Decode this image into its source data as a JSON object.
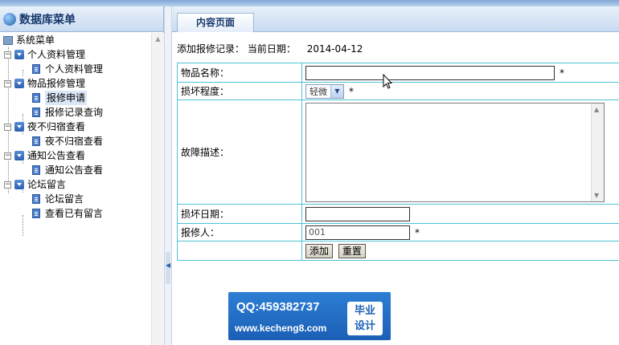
{
  "menu": {
    "title": "数据库菜单",
    "root": "系统菜单",
    "groups": [
      {
        "label": "个人资料管理",
        "items": [
          "个人资料管理"
        ]
      },
      {
        "label": "物品报修管理",
        "items": [
          "报修申请",
          "报修记录查询"
        ]
      },
      {
        "label": "夜不归宿查看",
        "items": [
          "夜不归宿查看"
        ]
      },
      {
        "label": "通知公告查看",
        "items": [
          "通知公告查看"
        ]
      },
      {
        "label": "论坛留言",
        "items": [
          "论坛留言",
          "查看已有留言"
        ]
      }
    ]
  },
  "content": {
    "tab": "内容页面",
    "caption": "添加报修记录：",
    "date_label": "当前日期：",
    "date_value": "2014-04-12",
    "form": {
      "item_name_label": "物品名称：",
      "item_name_value": "",
      "damage_label": "损坏程度：",
      "damage_selected": "轻微",
      "desc_label": "故障描述：",
      "damage_date_label": "损坏日期：",
      "damage_date_value": "",
      "reporter_label": "报修人：",
      "reporter_value": "001",
      "required_mark": "*",
      "add_button": "添加",
      "reset_button": "重置"
    }
  },
  "watermark": {
    "qq": "QQ:459382737",
    "url": "www.kecheng8.com",
    "badge_line1": "毕业",
    "badge_line2": "设计"
  }
}
